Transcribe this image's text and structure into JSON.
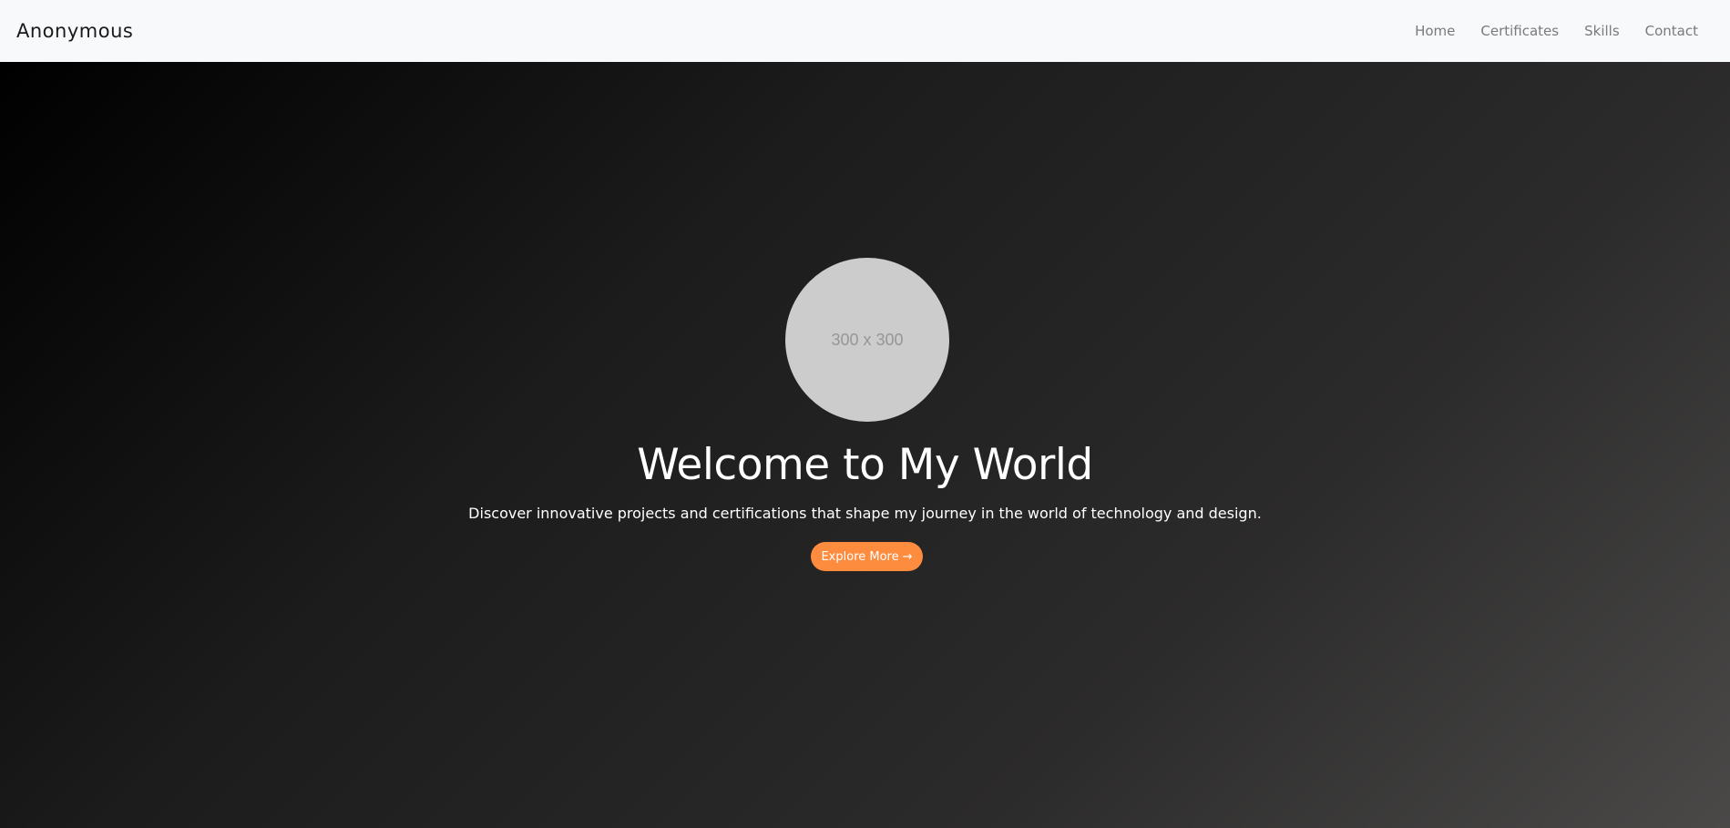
{
  "navbar": {
    "brand": "Anonymous",
    "links": [
      {
        "label": "Home"
      },
      {
        "label": "Certificates"
      },
      {
        "label": "Skills"
      },
      {
        "label": "Contact"
      }
    ]
  },
  "hero": {
    "avatar_placeholder": "300 x 300",
    "title": "Welcome to My World",
    "subtitle": "Discover innovative projects and certifications that shape my journey in the world of technology and design.",
    "cta_label": "Explore More",
    "cta_icon": "arrow-right-icon",
    "cta_color": "#fd8c3f"
  },
  "colors": {
    "navbar_bg": "#f8f9fa",
    "hero_gradient_start": "#000000",
    "hero_gradient_end": "#4a4948",
    "avatar_bg": "#cccccc"
  }
}
